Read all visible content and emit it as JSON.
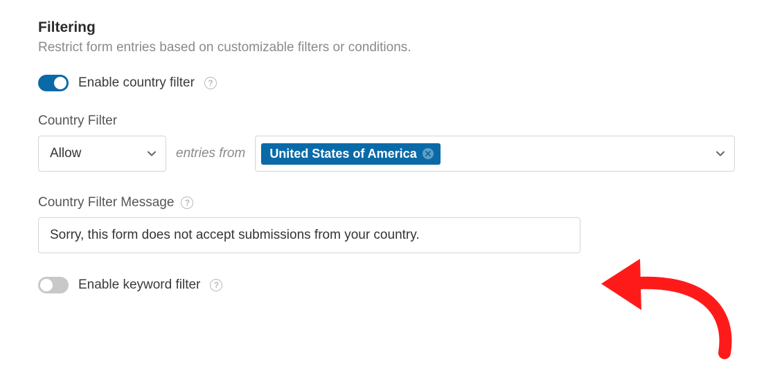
{
  "section": {
    "title": "Filtering",
    "description": "Restrict form entries based on customizable filters or conditions."
  },
  "country_filter_toggle": {
    "label": "Enable country filter",
    "enabled": true
  },
  "country_filter": {
    "label": "Country Filter",
    "action": "Allow",
    "entries_from": "entries from",
    "selected_country": "United States of America"
  },
  "country_filter_message": {
    "label": "Country Filter Message",
    "value": "Sorry, this form does not accept submissions from your country."
  },
  "keyword_filter_toggle": {
    "label": "Enable keyword filter",
    "enabled": false
  }
}
